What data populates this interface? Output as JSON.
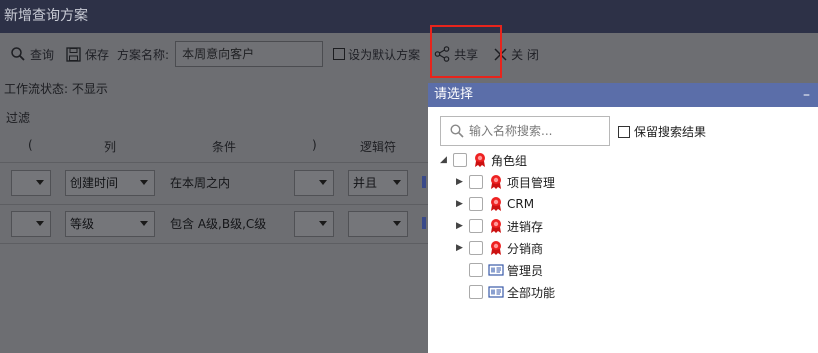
{
  "window": {
    "title": "新增查询方案"
  },
  "toolbar": {
    "query_label": "查询",
    "save_label": "保存",
    "scheme_name_label": "方案名称:",
    "scheme_name_value": "本周意向客户",
    "set_default_label": "设为默认方案",
    "share_label": "共享",
    "close_label": "关 闭"
  },
  "workflow": {
    "status_text": "工作流状态: 不显示"
  },
  "filter": {
    "label": "过滤",
    "headers": {
      "lparen": "(",
      "column": "列",
      "condition": "条件",
      "rparen": ")",
      "logic": "逻辑符"
    },
    "rows": [
      {
        "column": "创建时间",
        "condition": "在本周之内",
        "logic": "并且"
      },
      {
        "column": "等级",
        "condition": "包含 A级,B级,C级",
        "logic": ""
      }
    ]
  },
  "popup": {
    "title": "请选择",
    "minimize": "–",
    "search_placeholder": "输入名称搜索...",
    "keep_results_label": "保留搜索结果",
    "tree": {
      "root": {
        "label": "角色组",
        "icon": "ribbon-icon"
      },
      "children": [
        {
          "label": "项目管理",
          "icon": "ribbon-icon"
        },
        {
          "label": "CRM",
          "icon": "ribbon-icon"
        },
        {
          "label": "进销存",
          "icon": "ribbon-icon"
        },
        {
          "label": "分销商",
          "icon": "ribbon-icon"
        }
      ],
      "leaves": [
        {
          "label": "管理员",
          "icon": "id-card-icon"
        },
        {
          "label": "全部功能",
          "icon": "id-card-icon"
        }
      ]
    }
  },
  "colors": {
    "highlight": "#e8241c",
    "popup_header": "#5b6ea9",
    "titlebar": "#2d3147"
  }
}
